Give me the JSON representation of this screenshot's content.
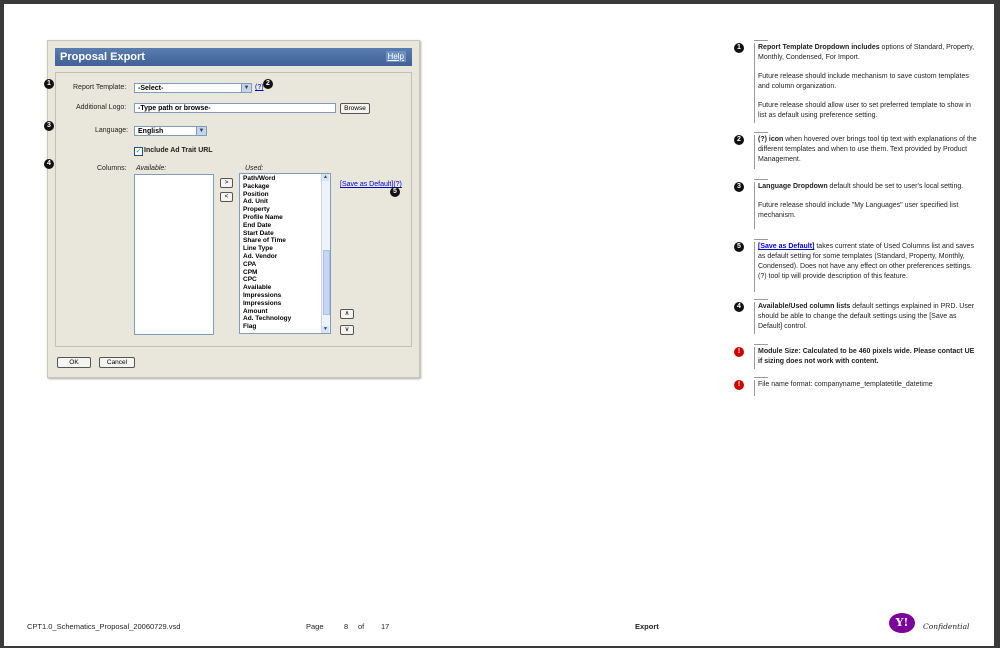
{
  "dialog": {
    "title": "Proposal Export",
    "help": "Help",
    "report_template_label": "Report Template:",
    "report_template_value": "-Select-",
    "qmark": "(?)",
    "additional_logo_label": "Additional Logo:",
    "additional_logo_value": "-Type path or browse-",
    "browse": "Browse",
    "language_label": "Language:",
    "language_value": "English",
    "include_label": "Include Ad Trait URL",
    "columns_label": "Columns:",
    "available_label": "Available:",
    "used_label": "Used:",
    "move_right": ">",
    "move_left": "<",
    "move_up": "∧",
    "move_down": "∨",
    "save_default": "[Save as Default]",
    "save_default_q": "(?)",
    "used_items": [
      "Path/Word",
      "Package",
      "Position",
      "Ad. Unit",
      "Property",
      "Profile Name",
      "End Date",
      "Start Date",
      "Share of Time",
      "Line Type",
      "Ad. Vendor",
      "CPA",
      "CPM",
      "CPC",
      "Available",
      "Impressions",
      "Impressions",
      "Amount",
      "Ad. Technology",
      "Flag"
    ],
    "ok": "OK",
    "cancel": "Cancel"
  },
  "callouts": {
    "c1": "1",
    "c2": "2",
    "c3": "3",
    "c4": "4",
    "c5": "5"
  },
  "notes": {
    "n1_bold": "Report Template Dropdown includes",
    "n1_text": " options of Standard, Property, Monthly, Condensed, For Import.",
    "n1_p2": "Future release should include mechanism to save custom templates and column organization.",
    "n1_p3": "Future release should allow user to set preferred template to show in list as default using preference setting.",
    "n2_bold": "(?) icon",
    "n2_text": " when hovered over brings tool tip text with explanations of the different templates and when to use them. Text provided by Product Management.",
    "n3_bold": "Language Dropdown",
    "n3_text": " default should be set to user's local setting.",
    "n3_p2": "Future release should include \"My Languages\" user specified list mechanism.",
    "n5_link": "[Save as Default]",
    "n5_text": " takes current state of Used Columns list and saves as default setting for some templates (Standard, Property, Monthly, Condensed). Does not have any effect on other preferences settings. (?) tool tip will provide description of this feature.",
    "n4_bold": "Available/Used column lists",
    "n4_text": " default settings explained in PRD. User should be able to change the default settings using the [Save as Default] control.",
    "r1_icon": "!",
    "r1_text": "Module Size: Calculated to be 460 pixels wide. Please contact UE if sizing does not work with content.",
    "r2_icon": "!",
    "r2_text": "File name format: companyname_templatetitle_datetime"
  },
  "footer": {
    "filename": "CPT1.0_Schematics_Proposal_20060729.vsd",
    "page_label": "Page",
    "page_num": "8",
    "of_label": "of",
    "page_total": "17",
    "section": "Export",
    "logo": "Y!",
    "confidential": "Confidential"
  },
  "colors": {
    "title_bar": "#3f6197",
    "dialog_bg": "#e9e7dc",
    "alert": "#cc0000",
    "yahoo": "#7b0099"
  }
}
